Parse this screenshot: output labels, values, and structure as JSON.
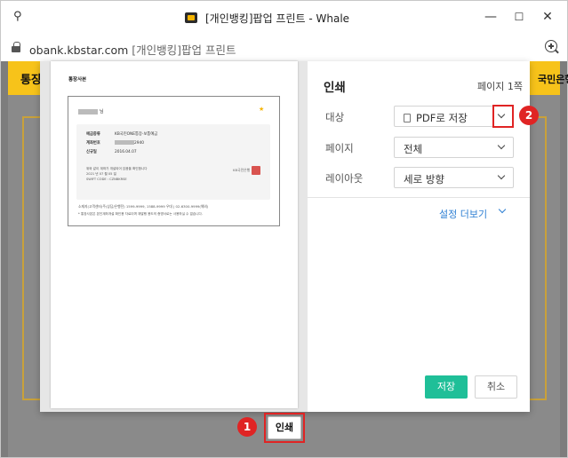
{
  "window": {
    "title": "[개인뱅킹]팝업 프린트 - Whale",
    "icons": [
      "pin-icon",
      "app-logo-icon",
      "minimize-icon",
      "maximize-icon",
      "close-icon"
    ]
  },
  "addressbar": {
    "url": "obank.kbstar.com",
    "page_title": "[개인뱅킹]팝업 프린트",
    "icons": [
      "lock-icon",
      "zoom-icon"
    ]
  },
  "background_page": {
    "left_label": "통장",
    "right_label": "국민은행",
    "print_button": "인쇄"
  },
  "preview": {
    "title": "통장사본",
    "name_suffix": "님",
    "rows": [
      {
        "label": "예금종류",
        "value": "KB국민ONE통장-보통예금"
      },
      {
        "label": "계좌번호",
        "value": "2940"
      },
      {
        "label": "신규일",
        "value": "2016.04.07"
      }
    ],
    "note_line1": "위와 같이 계좌가 개설되어 있음을 확인합니다",
    "note_line2": "2021 년 07 월 05 일",
    "note_line3": "SWIFT CODE : CZNBKRSE",
    "stamp_label": "KB국민은행",
    "footer1": "소재지(고객센터)주(상담/은행전) 1599-9999, 1588-9999 우대 | 02-6300-9999(해외)",
    "footer2": "* 통장사본은 본인계좌개설 확인용 자료이며 재발행 용도의 증명서로는 사용하실 수 없습니다."
  },
  "settings": {
    "title": "인쇄",
    "page_count": "페이지 1쪽",
    "destination": {
      "label": "대상",
      "value": "PDF로 저장"
    },
    "pages": {
      "label": "페이지",
      "value": "전체"
    },
    "layout": {
      "label": "레이아웃",
      "value": "세로 방향"
    },
    "more_settings": "설정 더보기",
    "save_button": "저장",
    "cancel_button": "취소"
  },
  "annotations": {
    "step1": "1",
    "step2": "2",
    "highlight_color": "#e02424"
  },
  "colors": {
    "accent_save": "#1fbf98",
    "link": "#2e7fd3",
    "brand_yellow": "#f7c31a"
  }
}
